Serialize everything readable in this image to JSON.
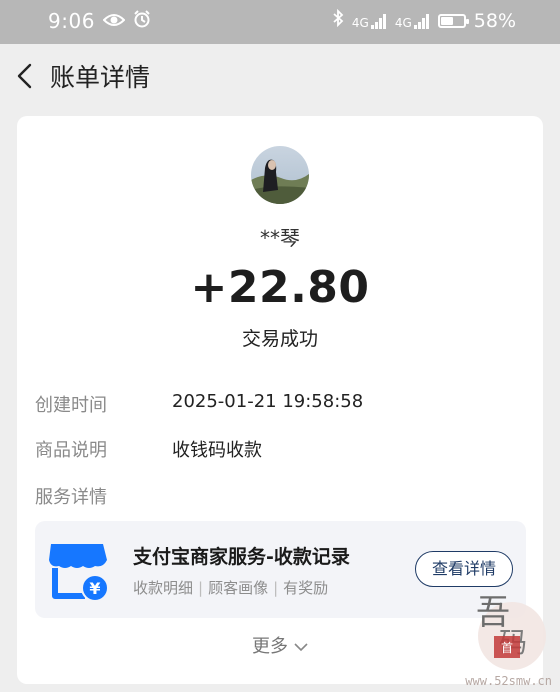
{
  "status_bar": {
    "time": "9:06",
    "signal_label_1": "4G",
    "signal_label_2": "4G",
    "battery_percent": "58%",
    "battery_level": 0.58
  },
  "nav": {
    "title": "账单详情"
  },
  "transaction": {
    "payer_name": "**琴",
    "amount": "+22.80",
    "status": "交易成功"
  },
  "details": [
    {
      "label": "创建时间",
      "value": "2025-01-21 19:58:58"
    },
    {
      "label": "商品说明",
      "value": "收钱码收款"
    },
    {
      "label": "服务详情",
      "value": ""
    }
  ],
  "service_card": {
    "title": "支付宝商家服务-收款记录",
    "subtitle_items": [
      "收款明细",
      "顾客画像",
      "有奖励"
    ],
    "button_label": "查看详情",
    "icon_color": "#1677ff"
  },
  "more": {
    "label": "更多"
  },
  "watermark": {
    "url": "www.52smw.cn"
  },
  "colors": {
    "status_bar_bg": "#b7b7b7",
    "page_bg": "#eeeeee",
    "card_bg": "#ffffff",
    "service_bg": "#f3f4f8",
    "button_border": "#1f3b66",
    "accent_blue": "#1677ff"
  }
}
